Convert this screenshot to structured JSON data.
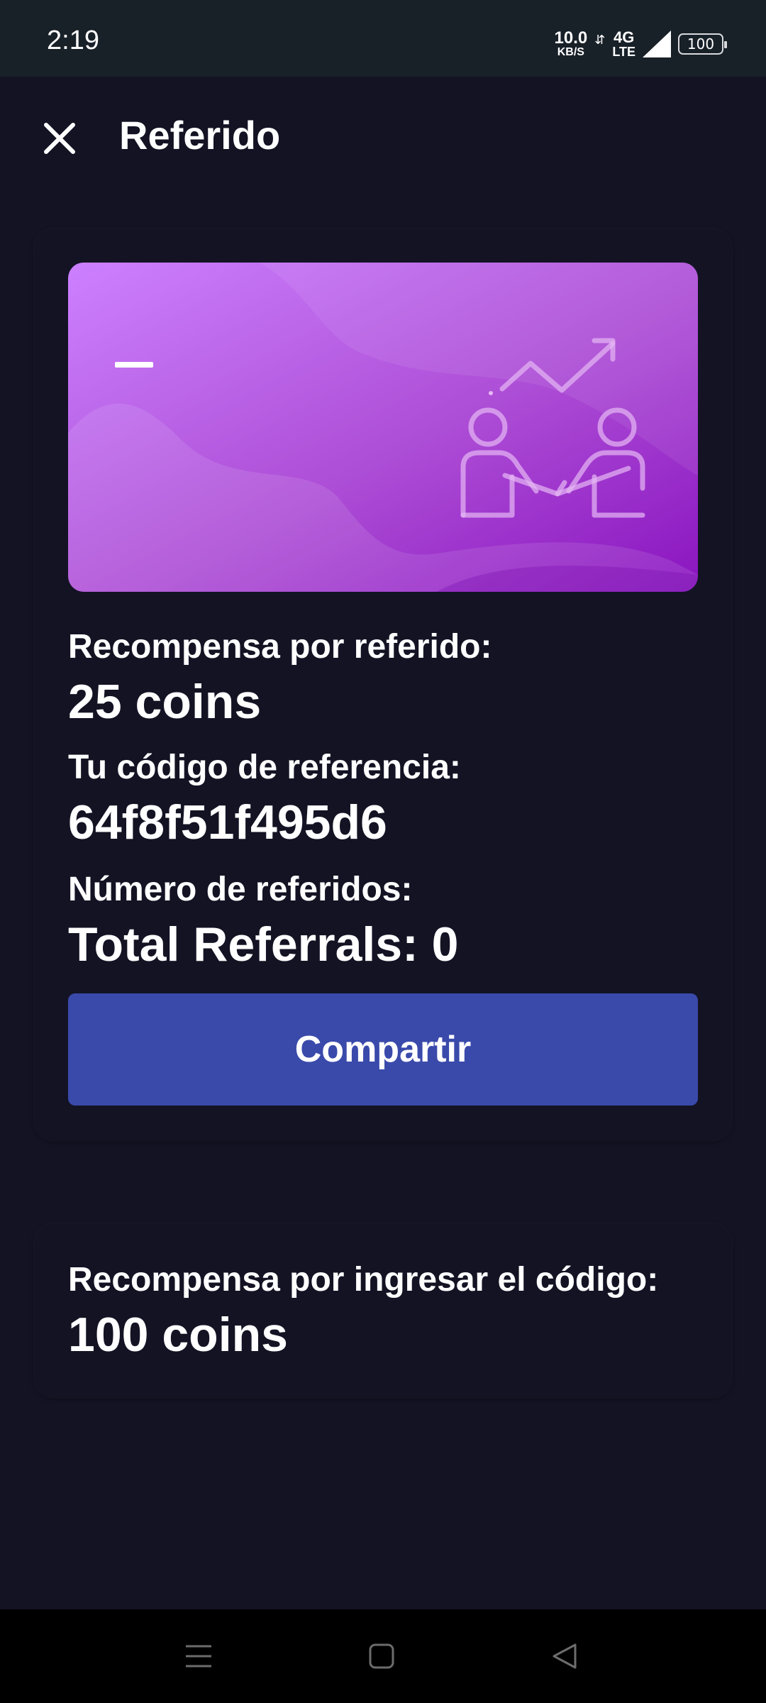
{
  "status_bar": {
    "time": "2:19",
    "net_speed_value": "10.0",
    "net_speed_unit": "KB/S",
    "net_type_top": "4G",
    "net_type_bottom": "LTE",
    "battery": "100"
  },
  "app_bar": {
    "title": "Referido",
    "close_icon": "close-icon"
  },
  "referral_card": {
    "banner_icon": "handshake-growth-illustration",
    "reward_label": "Recompensa por referido:",
    "reward_value": "25 coins",
    "code_label": "Tu código de referencia:",
    "code_value": "64f8f51f495d6",
    "count_label": "Número de referidos:",
    "count_value": "Total Referrals: 0",
    "share_button": "Compartir"
  },
  "code_reward_card": {
    "label": "Recompensa por ingresar el código:",
    "value": "100 coins"
  },
  "colors": {
    "background": "#131324",
    "accent_button": "#3a4aab",
    "banner_start": "#cc80ff",
    "banner_end": "#8a14c0"
  },
  "nav_bar": {
    "menu_icon": "menu-icon",
    "home_icon": "home-square-icon",
    "back_icon": "back-triangle-icon"
  }
}
